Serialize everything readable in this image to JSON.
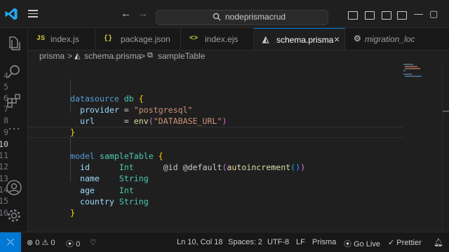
{
  "titlebar": {
    "search_text": "nodeprismacrud"
  },
  "tabs": [
    {
      "icon": "JS",
      "label": "index.js"
    },
    {
      "icon": "{}",
      "label": "package.json"
    },
    {
      "icon": "<>",
      "label": "index.ejs"
    },
    {
      "icon": "◭",
      "label": "schema.prisma",
      "close": "×"
    },
    {
      "icon": "⚙",
      "label": "migration_loc"
    }
  ],
  "breadcrumb": {
    "items": [
      "prisma",
      "schema.prisma",
      "sampleTable"
    ],
    "separator": ">"
  },
  "editor": {
    "line_numbers": [
      "4",
      "5",
      "6",
      "7",
      "8",
      "9",
      "10",
      "11",
      "12",
      "13",
      "14",
      "15",
      "16"
    ],
    "current_line": "10",
    "code": {
      "l4": "",
      "l5_kw": "datasource",
      "l5_name": "db",
      "l5_brace": "{",
      "l6_key": "provider",
      "l6_eq": " = ",
      "l6_val": "\"postgresql\"",
      "l7_key": "url",
      "l7_eq": "      = ",
      "l7_fn": "env",
      "l7_open": "(",
      "l7_val": "\"DATABASE_URL\"",
      "l7_close": ")",
      "l8_brace": "}",
      "l10_kw": "model",
      "l10_name": "sampleTable",
      "l10_brace": "{",
      "l11_field": "id",
      "l11_type": "Int",
      "l11_attr": "@id @default",
      "l11_p1": "(",
      "l11_fn": "autoincrement",
      "l11_p2": "()",
      "l11_p3": ")",
      "l12_field": "name",
      "l12_type": "String",
      "l13_field": "age",
      "l13_type": "Int",
      "l14_field": "country",
      "l14_type": "String",
      "l15_brace": "}"
    }
  },
  "statusbar": {
    "remote": "⤫",
    "errors": "0",
    "warnings": "0",
    "ports": "0",
    "position": "Ln 10, Col 18",
    "spaces": "Spaces: 2",
    "encoding": "UTF-8",
    "eol": "LF",
    "language": "Prisma",
    "golive": "Go Live",
    "prettier": "Prettier"
  },
  "colors": {
    "accent": "#0078d4",
    "editor_bg": "#1f1f1f",
    "sidebar_bg": "#181818"
  }
}
